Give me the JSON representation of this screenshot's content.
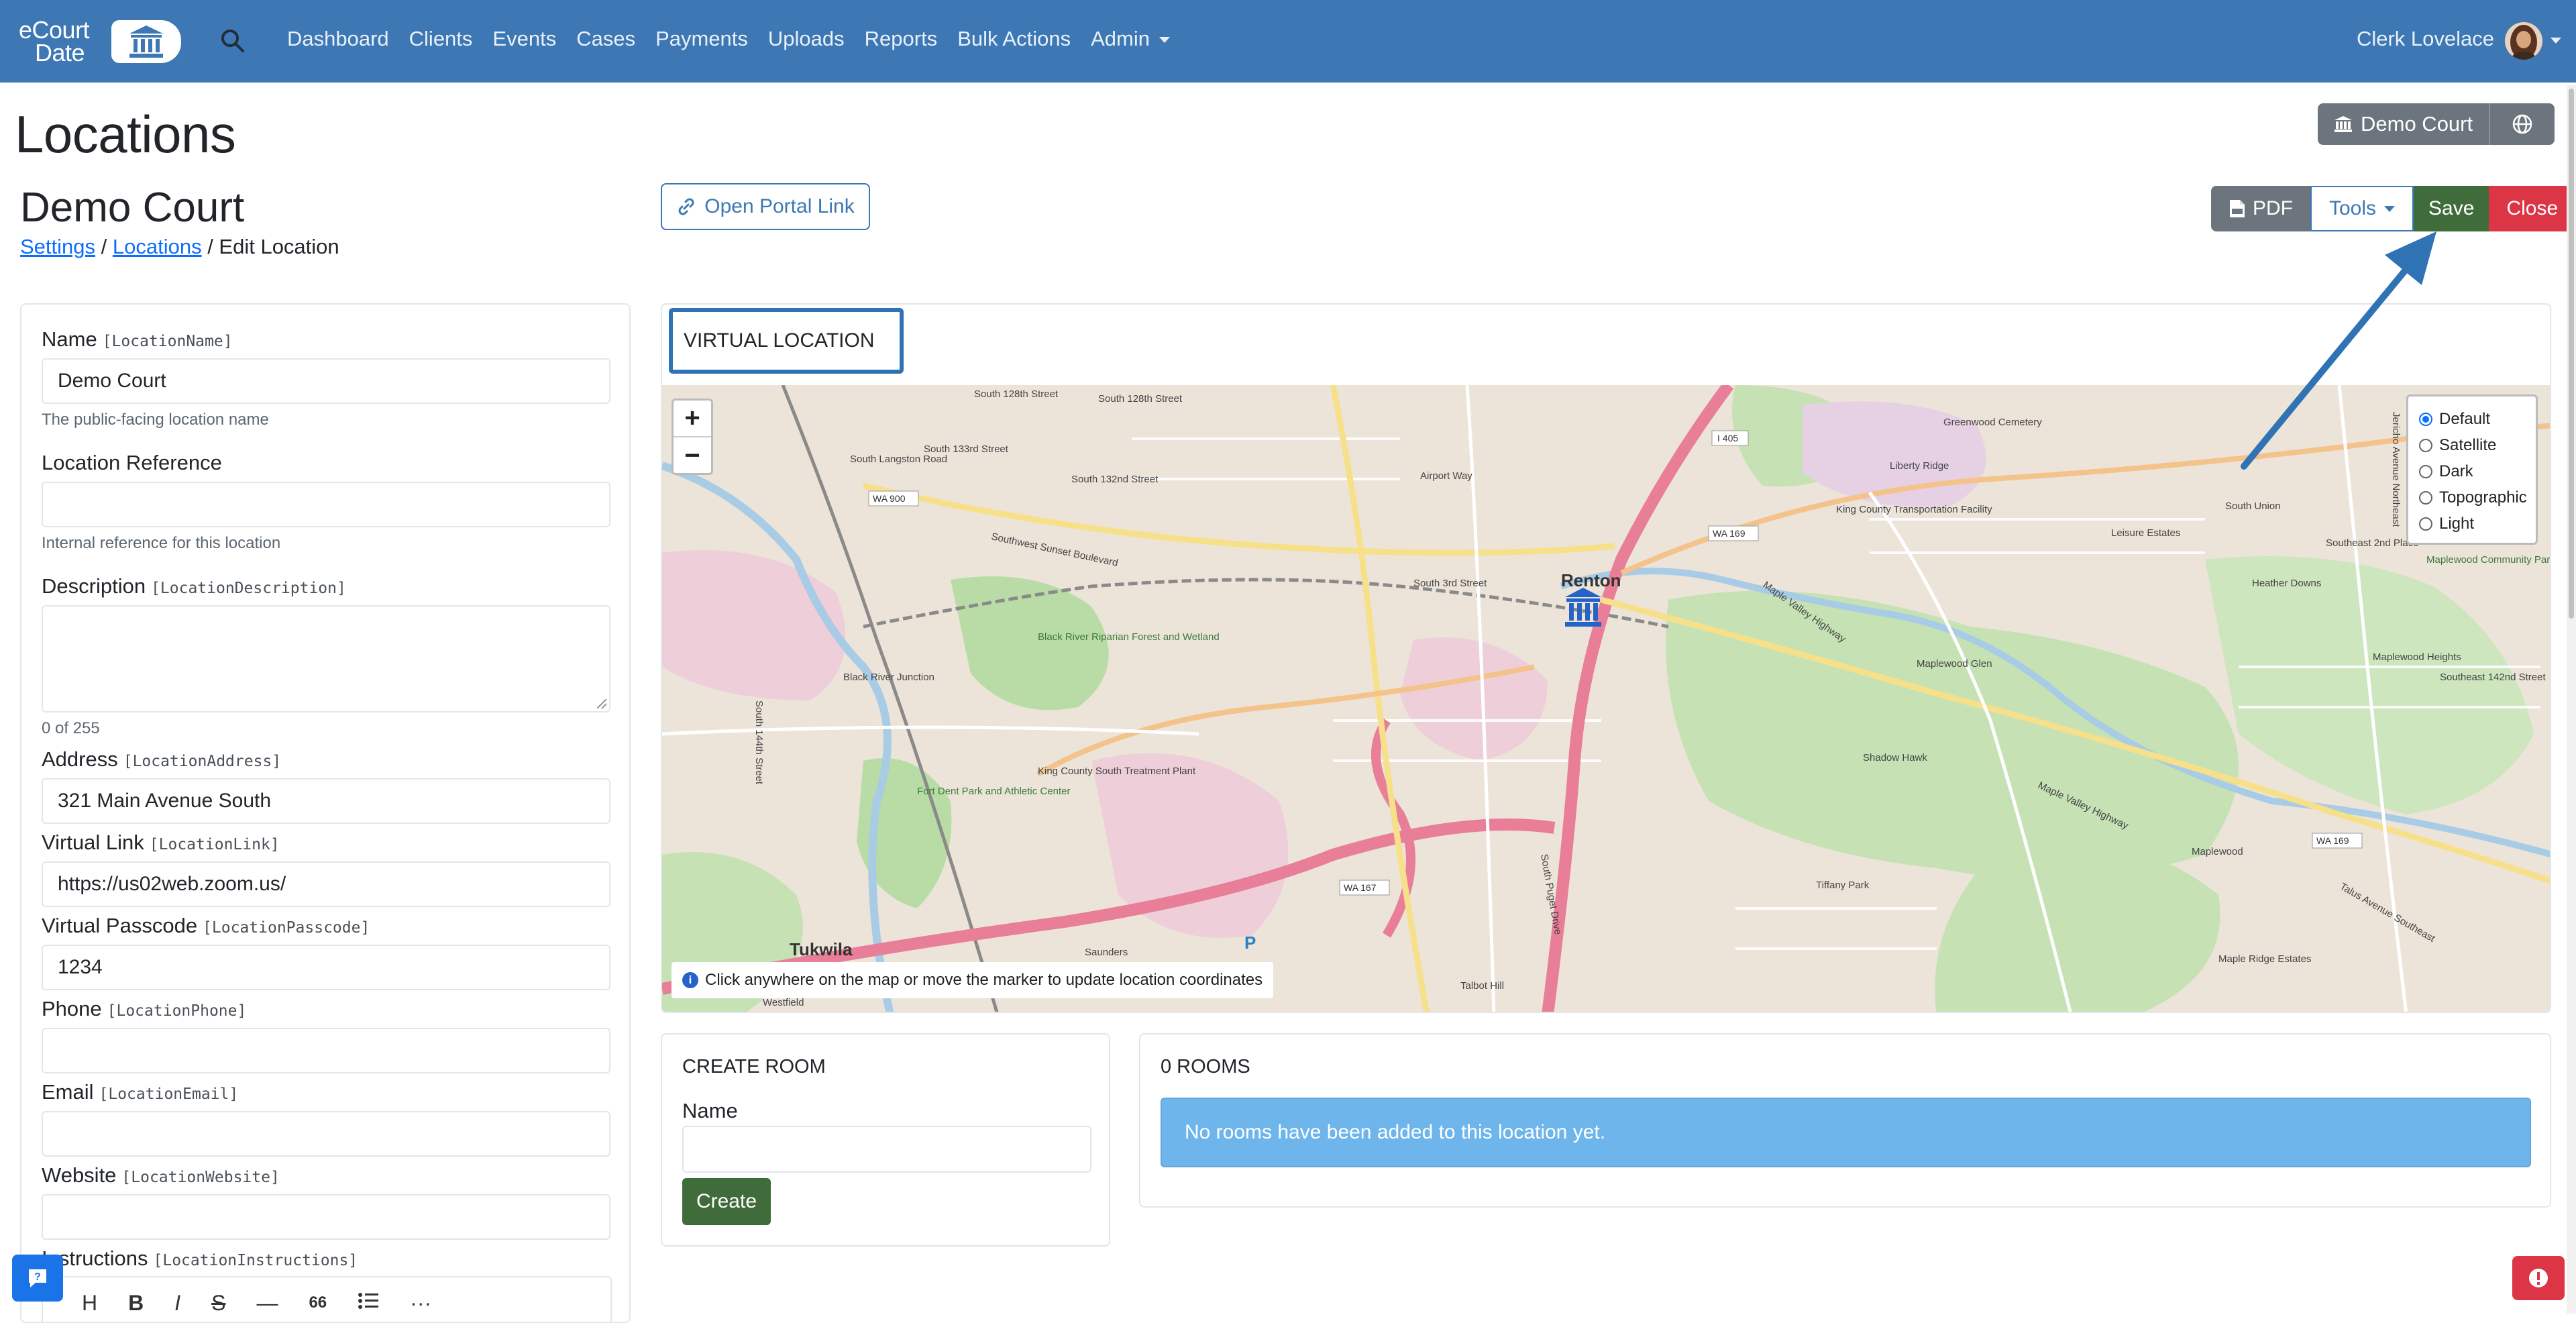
{
  "navbar": {
    "logo_line1": "eCourt",
    "logo_line2": "Date",
    "links": [
      "Dashboard",
      "Clients",
      "Events",
      "Cases",
      "Payments",
      "Uploads",
      "Reports",
      "Bulk Actions",
      "Admin"
    ],
    "user_name": "Clerk Lovelace"
  },
  "page": {
    "title": "Locations",
    "court_button": "Demo Court",
    "subtitle": "Demo Court",
    "breadcrumb": {
      "settings": "Settings",
      "sep1": " / ",
      "locations": "Locations",
      "sep2": " / ",
      "current": "Edit Location"
    },
    "portal_link": "Open Portal Link"
  },
  "toolbar": {
    "pdf": "PDF",
    "tools": "Tools",
    "save": "Save",
    "close": "Close"
  },
  "form": {
    "name": {
      "label": "Name",
      "code": "[LocationName]",
      "value": "Demo Court",
      "help": "The public-facing location name"
    },
    "reference": {
      "label": "Location Reference",
      "value": "",
      "help": "Internal reference for this location"
    },
    "description": {
      "label": "Description",
      "code": "[LocationDescription]",
      "counter": "0 of 255"
    },
    "address": {
      "label": "Address",
      "code": "[LocationAddress]",
      "value": "321 Main Avenue South"
    },
    "virtual_link": {
      "label": "Virtual Link",
      "code": "[LocationLink]",
      "value": "https://us02web.zoom.us/"
    },
    "passcode": {
      "label": "Virtual Passcode",
      "code": "[LocationPasscode]",
      "value": "1234"
    },
    "phone": {
      "label": "Phone",
      "code": "[LocationPhone]",
      "value": ""
    },
    "email": {
      "label": "Email",
      "code": "[LocationEmail]",
      "value": ""
    },
    "website": {
      "label": "Website",
      "code": "[LocationWebsite]",
      "value": ""
    },
    "instructions": {
      "label": "Instructions",
      "code": "[LocationInstructions]"
    },
    "editor_tools": [
      "H",
      "B",
      "I",
      "S",
      "—",
      "66",
      "list",
      "···"
    ]
  },
  "map": {
    "section_title": "VIRTUAL LOCATION",
    "zoom_in": "+",
    "zoom_out": "−",
    "layers": [
      "Default",
      "Satellite",
      "Dark",
      "Topographic",
      "Light"
    ],
    "selected_layer": "Default",
    "hint": "Click anywhere on the map or move the marker to update location coordinates",
    "labels": [
      "Renton",
      "Tukwila",
      "South 128th Street",
      "South 132nd Street",
      "South 133rd Street",
      "South Langston Road",
      "Airport Way",
      "South 3rd Street",
      "Southwest Sunset Boulevard",
      "Black River Junction",
      "Black River Riparian Forest and Wetland",
      "King County South Treatment Plant",
      "Fort Dent Park and Athletic Center",
      "Maple Valley Highway",
      "Greenwood Cemetery",
      "King County Transportation Facility",
      "Liberty Ridge",
      "Leisure Estates",
      "South Union",
      "Southeast 2nd Place",
      "Maplewood Community Park",
      "Heather Downs",
      "Maplewood Heights",
      "Southeast 142nd Street",
      "Maplewood Glen",
      "Shadow Hawk",
      "Maplewood",
      "Tiffany Park",
      "Talbot Hill",
      "South Puget Drive",
      "Maple Ridge Estates",
      "Saunders",
      "Westfield",
      "South 144th Street",
      "Jericho Avenue Northeast",
      "Talus Avenue Southeast",
      "WA 900",
      "WA 169",
      "WA 167",
      "I 405",
      "P"
    ]
  },
  "create_room": {
    "title": "CREATE ROOM",
    "name_label": "Name",
    "button": "Create"
  },
  "rooms": {
    "title": "0 ROOMS",
    "empty": "No rooms have been added to this location yet."
  },
  "colors": {
    "navbar": "#3d78b5",
    "save": "#3f6c3a",
    "close": "#dc3545",
    "alert": "#6eb5ec",
    "annotation": "#2f73b4"
  },
  "icons": [
    "bank-icon",
    "search-icon",
    "globe-icon",
    "pdf-icon",
    "link-icon",
    "info-icon",
    "chat-icon",
    "alert-icon",
    "map-marker-icon"
  ]
}
